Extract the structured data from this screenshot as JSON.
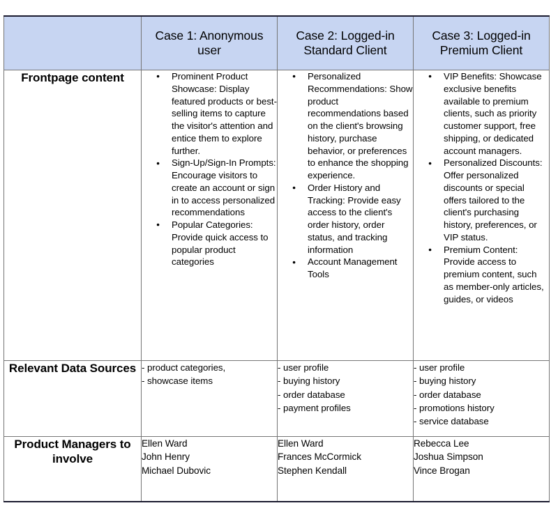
{
  "table": {
    "corner_label": "",
    "columns": [
      {
        "id": "col-label",
        "header": ""
      },
      {
        "id": "col-case-1",
        "header": "Case 1: Anonymous user"
      },
      {
        "id": "col-case-2",
        "header": "Case 2: Logged-in Standard Client"
      },
      {
        "id": "col-case-3",
        "header": "Case 3: Logged-in Premium Client"
      }
    ],
    "header_background": "#c7d5f2",
    "border_color": "#757575",
    "rows": [
      {
        "id": "row-frontpage-content",
        "label": "Frontpage content",
        "type": "bullets",
        "cells": [
          {
            "id": "frontpage-case-1",
            "items": [
              "Prominent Product Showcase: Display featured products or best-selling items to capture the visitor's attention and entice them to explore further.",
              "Sign-Up/Sign-In Prompts: Encourage visitors to create an account or sign in to access personalized recommendations",
              "Popular Categories: Provide quick access to popular product categories"
            ]
          },
          {
            "id": "frontpage-case-2",
            "items": [
              "Personalized Recommendations: Show product recommendations based on the client's browsing history, purchase behavior, or preferences to enhance the shopping experience.",
              "Order History and Tracking: Provide easy access to the client's order history, order status, and tracking information",
              "Account Management Tools"
            ]
          },
          {
            "id": "frontpage-case-3",
            "items": [
              "VIP Benefits: Showcase exclusive benefits available to premium clients, such as priority customer support, free shipping, or dedicated account managers.",
              "Personalized Discounts: Offer personalized discounts or special offers tailored to the client's purchasing history, preferences, or VIP status.",
              "Premium Content: Provide access to premium content, such as member-only articles, guides, or videos"
            ]
          }
        ]
      },
      {
        "id": "row-relevant-data-sources",
        "label": "Relevant Data Sources",
        "type": "dash-list",
        "cells": [
          {
            "id": "sources-case-1",
            "items": [
              "- product categories,",
              "- showcase items"
            ]
          },
          {
            "id": "sources-case-2",
            "items": [
              "- user profile",
              "- buying history",
              "- order database",
              "- payment profiles"
            ]
          },
          {
            "id": "sources-case-3",
            "items": [
              "- user profile",
              "- buying history",
              "- order database",
              "- promotions history",
              "- service database"
            ]
          }
        ]
      },
      {
        "id": "row-product-managers",
        "label": "Product Managers to involve",
        "type": "names",
        "cells": [
          {
            "id": "managers-case-1",
            "items": [
              "Ellen Ward",
              "John Henry",
              "Michael Dubovic"
            ]
          },
          {
            "id": "managers-case-2",
            "items": [
              "Ellen Ward",
              "Frances McCormick",
              "Stephen Kendall"
            ]
          },
          {
            "id": "managers-case-3",
            "items": [
              "Rebecca Lee",
              "Joshua Simpson",
              "Vince Brogan"
            ]
          }
        ]
      }
    ]
  }
}
